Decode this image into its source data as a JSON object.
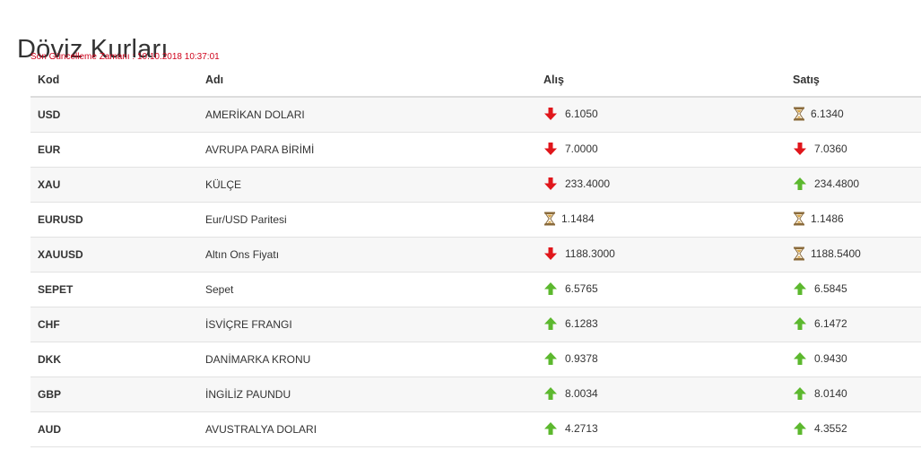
{
  "page": {
    "title": "Döviz Kurları",
    "last_update": "Son Güncelleme Zamanı : 10.10.2018 10:37:01"
  },
  "table": {
    "headers": {
      "code": "Kod",
      "name": "Adı",
      "buy": "Alış",
      "sell": "Satış"
    },
    "rows": [
      {
        "code": "USD",
        "name": "AMERİKAN DOLARI",
        "buy": "6.1050",
        "buy_trend": "down",
        "sell": "6.1340",
        "sell_trend": "same"
      },
      {
        "code": "EUR",
        "name": "AVRUPA PARA BİRİMİ",
        "buy": "7.0000",
        "buy_trend": "down",
        "sell": "7.0360",
        "sell_trend": "down"
      },
      {
        "code": "XAU",
        "name": "KÜLÇE",
        "buy": "233.4000",
        "buy_trend": "down",
        "sell": "234.4800",
        "sell_trend": "up"
      },
      {
        "code": "EURUSD",
        "name": "Eur/USD Paritesi",
        "buy": "1.1484",
        "buy_trend": "same",
        "sell": "1.1486",
        "sell_trend": "same"
      },
      {
        "code": "XAUUSD",
        "name": "Altın Ons Fiyatı",
        "buy": "1188.3000",
        "buy_trend": "down",
        "sell": "1188.5400",
        "sell_trend": "same"
      },
      {
        "code": "SEPET",
        "name": "Sepet",
        "buy": "6.5765",
        "buy_trend": "up",
        "sell": "6.5845",
        "sell_trend": "up"
      },
      {
        "code": "CHF",
        "name": "İSVİÇRE FRANGI",
        "buy": "6.1283",
        "buy_trend": "up",
        "sell": "6.1472",
        "sell_trend": "up"
      },
      {
        "code": "DKK",
        "name": "DANİMARKA KRONU",
        "buy": "0.9378",
        "buy_trend": "up",
        "sell": "0.9430",
        "sell_trend": "up"
      },
      {
        "code": "GBP",
        "name": "İNGİLİZ PAUNDU",
        "buy": "8.0034",
        "buy_trend": "up",
        "sell": "8.0140",
        "sell_trend": "up"
      },
      {
        "code": "AUD",
        "name": "AVUSTRALYA DOLARI",
        "buy": "4.2713",
        "buy_trend": "up",
        "sell": "4.3552",
        "sell_trend": "up"
      }
    ]
  },
  "icons": {
    "up": "arrow-up-icon",
    "down": "arrow-down-icon",
    "same": "hourglass-icon"
  },
  "colors": {
    "up": "#5cb82e",
    "down": "#e0161b",
    "same": "#8a6a3a",
    "update_text": "#d0021b"
  }
}
